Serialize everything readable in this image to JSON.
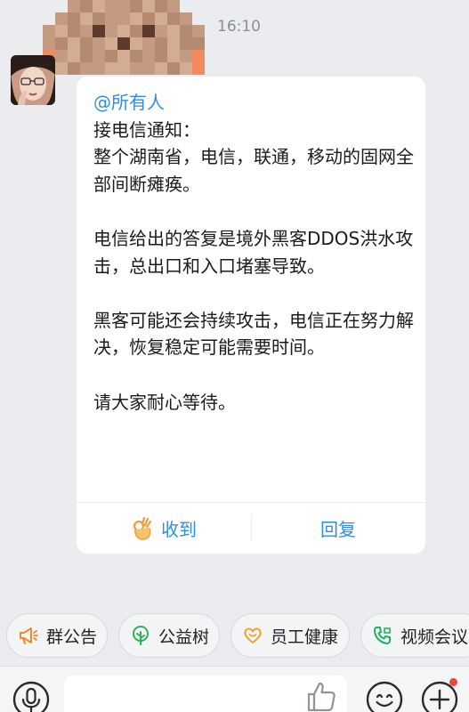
{
  "header": {
    "timestamp": "16:10"
  },
  "sender": {
    "avatar_icon": "profile-photo-illustration"
  },
  "message": {
    "mention": "@所有人",
    "paragraphs": [
      "接电信通知：",
      "整个湖南省，电信，联通，移动的固网全部间断瘫痪。",
      "",
      "电信给出的答复是境外黑客DDOS洪水攻击，总出口和入口堵塞导致。",
      "",
      "黑客可能还会持续攻击，电信正在努力解决，恢复稳定可能需要时间。",
      "",
      "请大家耐心等待。"
    ],
    "actions": {
      "ack_label": "收到",
      "ack_icon": "ok-hand-icon",
      "reply_label": "回复"
    }
  },
  "shortcuts": [
    {
      "label": "群公告",
      "icon": "megaphone-icon",
      "color": "#f08a24"
    },
    {
      "label": "公益树",
      "icon": "tree-icon",
      "color": "#2db45d"
    },
    {
      "label": "员工健康",
      "icon": "heart-icon",
      "color": "#f2a12b"
    },
    {
      "label": "视频会议",
      "icon": "video-call-icon",
      "color": "#1fae63"
    }
  ],
  "input_bar": {
    "voice_icon": "microphone-icon",
    "like_icon": "thumbs-up-icon",
    "emoji_icon": "emoji-icon",
    "more_icon": "plus-icon",
    "notification_color": "#f0433a"
  },
  "colors": {
    "accent": "#2e8ee6",
    "background": "#eaecef",
    "bubble": "#ffffff"
  }
}
